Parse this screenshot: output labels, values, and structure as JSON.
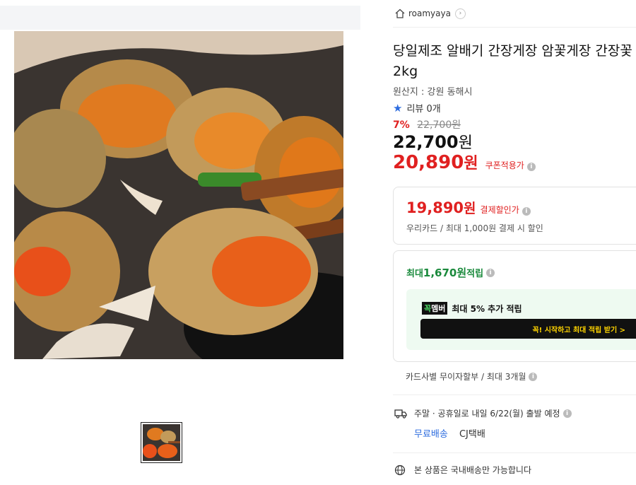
{
  "seller": {
    "name": "roamyaya"
  },
  "product": {
    "title_line1": "당일제조 알배기 간장게장 암꽃게장 간장꽃",
    "title_line2": "2kg",
    "origin": "원산지 : 강원 동해시",
    "review": "리뷰 0개"
  },
  "pricing": {
    "discount_rate": "7%",
    "original_price": "22,700원",
    "price": "22,700",
    "price_unit": "원",
    "coupon_price": "20,890",
    "coupon_unit": "원",
    "coupon_label": "쿠폰적용가"
  },
  "payment_discount": {
    "price": "19,890",
    "unit": "원",
    "label": "결제할인가",
    "description": "우리카드 / 최대 1,000원 결제 시 할인"
  },
  "points": {
    "prefix": "최대 ",
    "amount": "1,670원",
    "suffix": " 적립",
    "member_badge_g": "꼭",
    "member_badge_rest": "멤버",
    "member_text": "최대 5% 추가 적립",
    "cta_label": "꼭! 시작하고 최대 적립 받기 >"
  },
  "installment": "카드사별 무이자할부 / 최대 3개월",
  "shipping": {
    "schedule": "주말 · 공휴일로 내일 6/22(월) 출발 예정",
    "free": "무료배송",
    "carrier": "CJ택배"
  },
  "domestic_notice": "본 상품은 국내배송만 가능합니다",
  "colors": {
    "red": "#e02020",
    "green": "#1a8a3c",
    "blue": "#2d6cdf",
    "cta_text": "#ffd400"
  }
}
